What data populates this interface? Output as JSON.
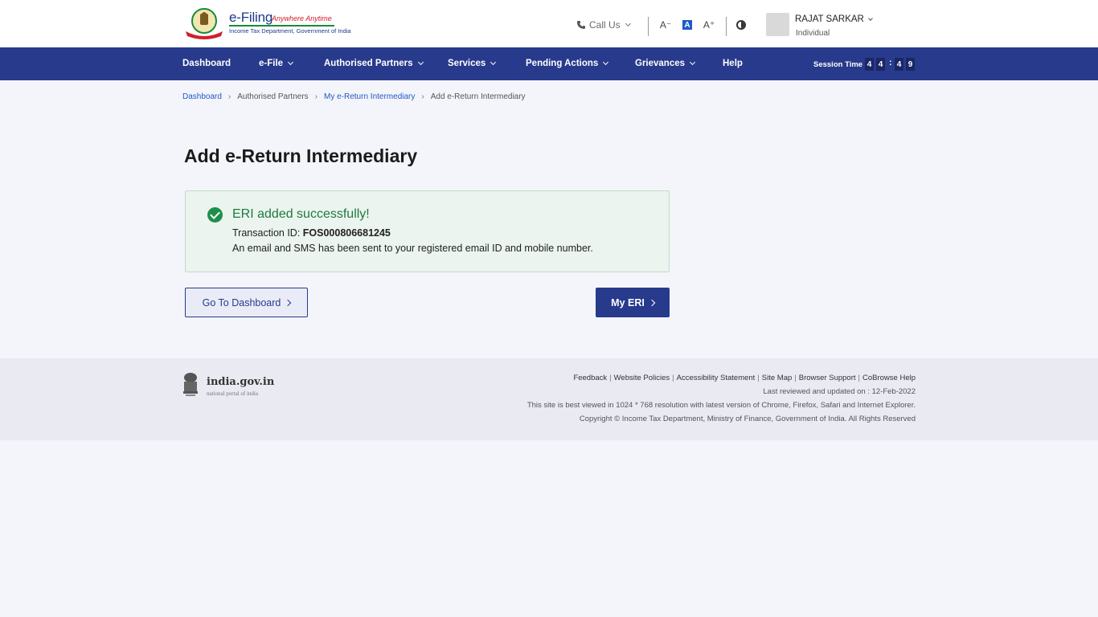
{
  "header": {
    "logo_title": "e-Filing",
    "logo_tagline": "Anywhere Anytime",
    "logo_subtitle": "Income Tax Department, Government of India",
    "call_us": "Call Us",
    "font_decrease": "A⁻",
    "font_normal": "A",
    "font_increase": "A⁺",
    "user_name": "RAJAT SARKAR",
    "user_role": "Individual"
  },
  "nav": {
    "items": [
      {
        "label": "Dashboard"
      },
      {
        "label": "e-File"
      },
      {
        "label": "Authorised Partners"
      },
      {
        "label": "Services"
      },
      {
        "label": "Pending Actions"
      },
      {
        "label": "Grievances"
      },
      {
        "label": "Help"
      }
    ],
    "session_label": "Session Time",
    "session_digits": [
      "4",
      "4",
      "4",
      "9"
    ],
    "session_colon": ":"
  },
  "breadcrumb": {
    "items": [
      "Dashboard",
      "Authorised Partners",
      "My e-Return Intermediary",
      "Add e-Return Intermediary"
    ],
    "separator": "›"
  },
  "page": {
    "title": "Add e-Return Intermediary"
  },
  "success": {
    "title": "ERI added successfully!",
    "txn_label": "Transaction ID: ",
    "txn_id": "FOS000806681245",
    "message": "An email and SMS has been sent to your registered email ID and mobile number."
  },
  "buttons": {
    "dashboard": "Go To Dashboard",
    "my_eri": "My ERI"
  },
  "footer": {
    "portal_title": "india.gov.in",
    "portal_sub": "national portal of india",
    "links": [
      "Feedback",
      "Website Policies",
      "Accessibility Statement",
      "Site Map",
      "Browser Support",
      "CoBrowse Help"
    ],
    "link_separator": "|",
    "last_reviewed": "Last reviewed and updated on : 12-Feb-2022",
    "best_viewed": "This site is best viewed in 1024 * 768 resolution with latest version of Chrome, Firefox, Safari and Internet Explorer.",
    "copyright": "Copyright © Income Tax Department, Ministry of Finance, Government of India. All Rights Reserved"
  },
  "colors": {
    "nav_bg": "#273a8c",
    "success_bg": "#ebf4ee",
    "success_green": "#1e8f4a",
    "link_blue": "#1f58c8"
  }
}
